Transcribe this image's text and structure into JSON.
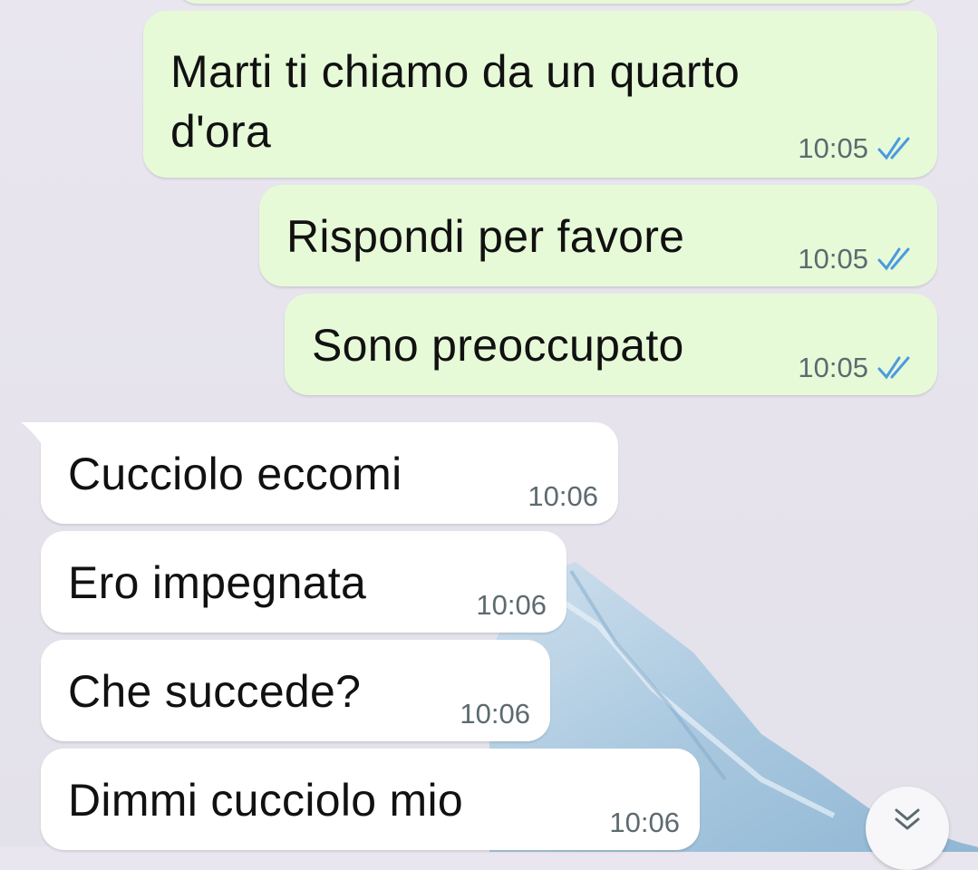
{
  "chat": {
    "messages": [
      {
        "direction": "outgoing",
        "text_lines": [
          "Marti ti chiamo da un quarto",
          "d'ora"
        ],
        "time": "10:05",
        "status": "read"
      },
      {
        "direction": "outgoing",
        "text": "Rispondi per favore",
        "time": "10:05",
        "status": "read"
      },
      {
        "direction": "outgoing",
        "text": "Sono preoccupato",
        "time": "10:05",
        "status": "read"
      },
      {
        "direction": "incoming",
        "text": "Cucciolo eccomi",
        "time": "10:06"
      },
      {
        "direction": "incoming",
        "text": "Ero impegnata",
        "time": "10:06"
      },
      {
        "direction": "incoming",
        "text": "Che succede?",
        "time": "10:06"
      },
      {
        "direction": "incoming",
        "text": "Dimmi cucciolo mio",
        "time": "10:06"
      }
    ]
  },
  "colors": {
    "outgoing_bubble": "#e7fad8",
    "incoming_bubble": "#ffffff",
    "read_ticks": "#4a9be0",
    "timestamp": "#5d6a6f"
  },
  "icons": {
    "read_status": "double-check-icon",
    "scroll_to_bottom": "chevron-double-down-icon"
  }
}
